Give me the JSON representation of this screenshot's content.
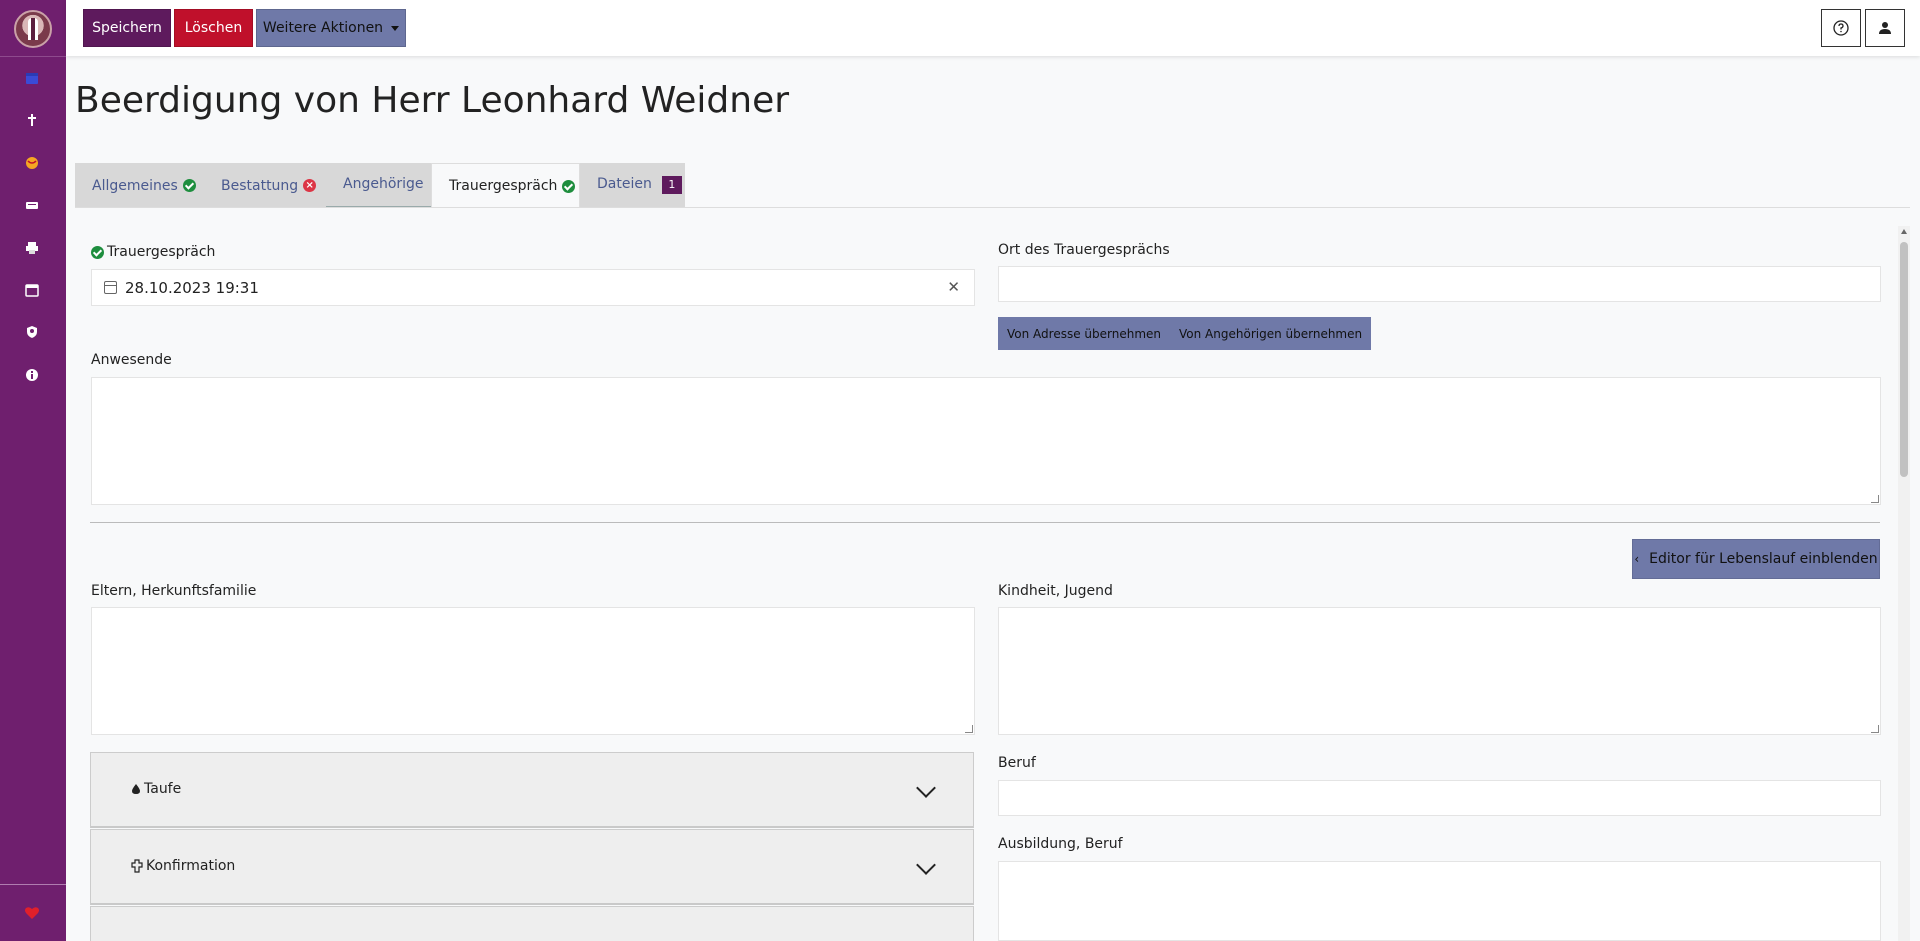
{
  "toolbar": {
    "save_label": "Speichern",
    "delete_label": "Löschen",
    "more_label": "Weitere Aktionen"
  },
  "page": {
    "title": "Beerdigung von Herr Leonhard Weidner"
  },
  "tabs": [
    {
      "label": "Allgemeines",
      "status": "check"
    },
    {
      "label": "Bestattung",
      "status": "error"
    },
    {
      "label": "Angehörige",
      "status": ""
    },
    {
      "label": "Trauergespräch",
      "status": "check"
    },
    {
      "label": "Dateien",
      "badge": "1"
    }
  ],
  "form": {
    "trauergespraech_label": "Trauergespräch",
    "trauergespraech_value": "28.10.2023 19:31",
    "ort_label": "Ort des Trauergesprächs",
    "ort_value": "",
    "btn_from_address": "Von Adresse übernehmen",
    "btn_from_relatives": "Von Angehörigen übernehmen",
    "anwesende_label": "Anwesende",
    "editor_button": "Editor für Lebenslauf einblenden",
    "eltern_label": "Eltern, Herkunftsfamilie",
    "kindheit_label": "Kindheit, Jugend",
    "beruf_label": "Beruf",
    "ausbildung_label": "Ausbildung, Beruf"
  },
  "accordions": [
    {
      "label": "Taufe",
      "icon": "drop-icon"
    },
    {
      "label": "Konfirmation",
      "icon": "cross-icon"
    }
  ],
  "colors": {
    "sidebar": "#6f1f6e",
    "save": "#5e1a5d",
    "delete": "#c0102b",
    "secondary": "#6f79a8",
    "success": "#1e8e3e",
    "danger": "#dc3545"
  }
}
